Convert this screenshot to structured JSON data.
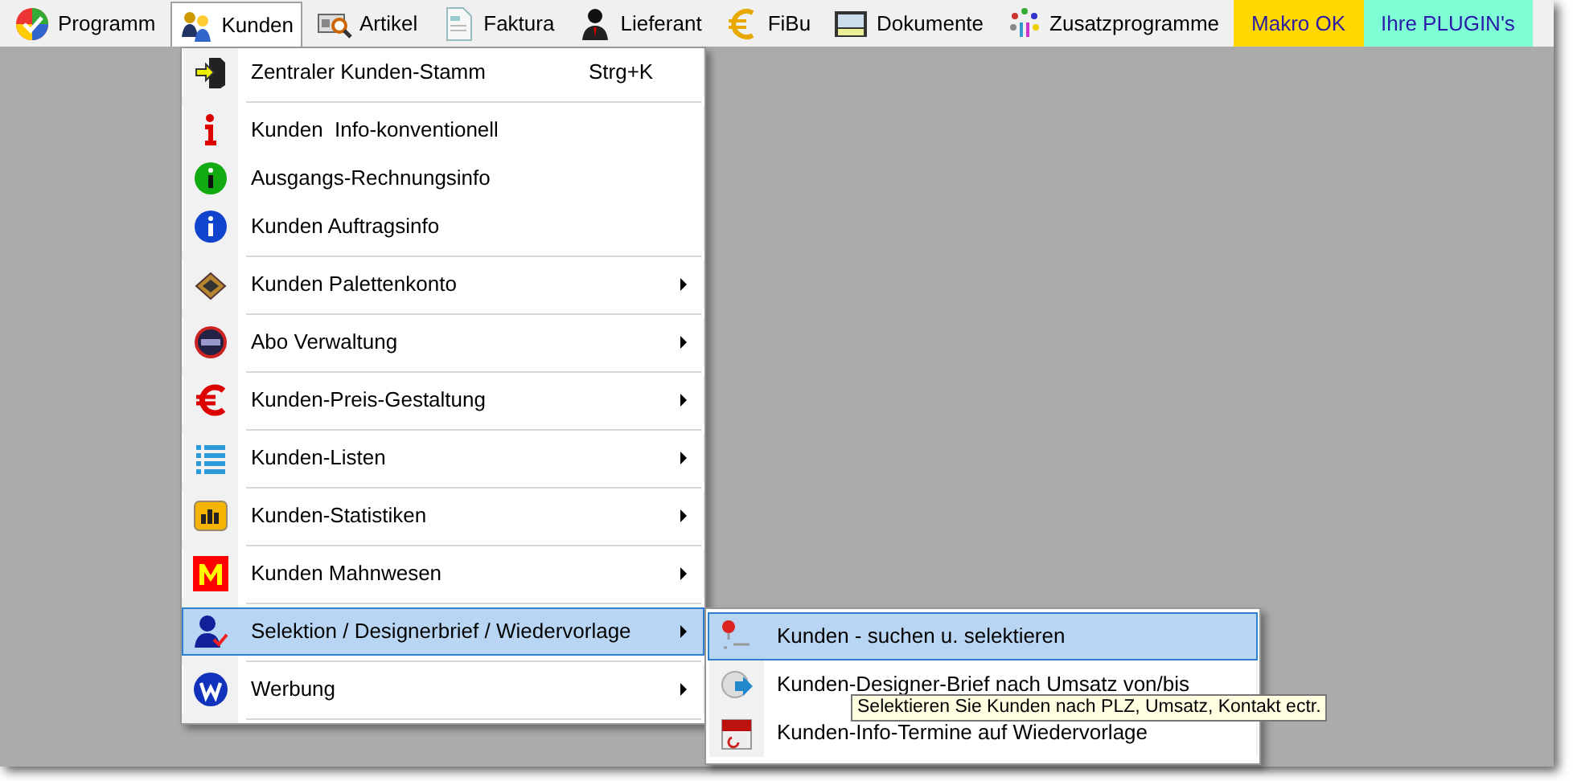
{
  "menubar": [
    {
      "label": "Programm",
      "selected": false
    },
    {
      "label": "Kunden",
      "selected": true
    },
    {
      "label": "Artikel",
      "selected": false
    },
    {
      "label": "Faktura",
      "selected": false
    },
    {
      "label": "Lieferant",
      "selected": false
    },
    {
      "label": "FiBu",
      "selected": false
    },
    {
      "label": "Dokumente",
      "selected": false
    },
    {
      "label": "Zusatzprogramme",
      "selected": false
    },
    {
      "label": "Makro OK",
      "selected": false,
      "color": "#ffd800"
    },
    {
      "label": "Ihre PLUGIN's",
      "selected": false,
      "color": "#7fffd4"
    }
  ],
  "menu": {
    "sections": [
      [
        {
          "label": "Zentraler Kunden-Stamm",
          "shortcut": "Strg+K",
          "submenu": false,
          "selected": false
        }
      ],
      [
        {
          "label": "Kunden  Info-konventionell",
          "submenu": false,
          "selected": false
        },
        {
          "label": "Ausgangs-Rechnungsinfo",
          "submenu": false,
          "selected": false
        },
        {
          "label": "Kunden Auftragsinfo",
          "submenu": false,
          "selected": false
        }
      ],
      [
        {
          "label": "Kunden Palettenkonto",
          "submenu": true,
          "selected": false
        }
      ],
      [
        {
          "label": "Abo Verwaltung",
          "submenu": true,
          "selected": false
        }
      ],
      [
        {
          "label": "Kunden-Preis-Gestaltung",
          "submenu": true,
          "selected": false
        }
      ],
      [
        {
          "label": "Kunden-Listen",
          "submenu": true,
          "selected": false
        }
      ],
      [
        {
          "label": "Kunden-Statistiken",
          "submenu": true,
          "selected": false
        }
      ],
      [
        {
          "label": "Kunden Mahnwesen",
          "submenu": true,
          "selected": false
        }
      ],
      [
        {
          "label": "Selektion / Designerbrief / Wiedervorlage",
          "submenu": true,
          "selected": true
        }
      ],
      [
        {
          "label": "Werbung",
          "submenu": true,
          "selected": false
        }
      ]
    ]
  },
  "submenu": {
    "items": [
      {
        "label": "Kunden - suchen u. selektieren",
        "selected": true
      },
      {
        "label": "Kunden-Designer-Brief nach Umsatz von/bis",
        "selected": false
      },
      {
        "label": "Kunden-Info-Termine auf Wiedervorlage",
        "selected": false
      }
    ]
  },
  "tooltip": {
    "text": "Selektieren Sie Kunden nach PLZ, Umsatz, Kontakt ectr."
  }
}
